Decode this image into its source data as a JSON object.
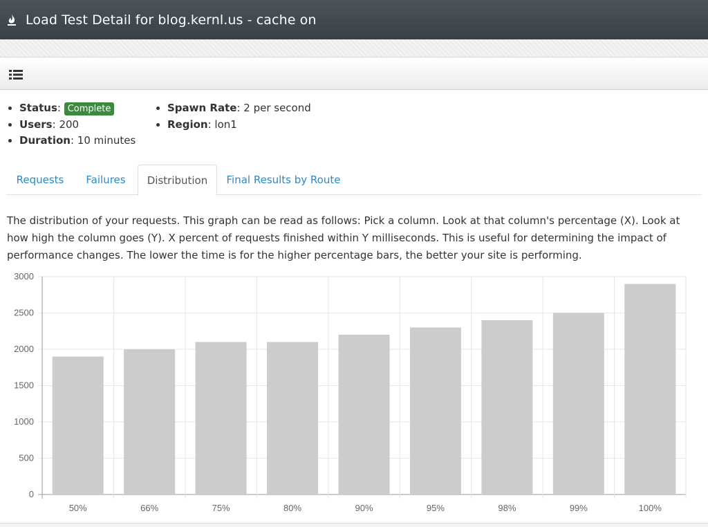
{
  "header": {
    "title": "Load Test Detail for blog.kernl.us - cache on",
    "icon": "flame-icon"
  },
  "toolbar": {
    "menu_icon": "list-icon"
  },
  "info": {
    "left": [
      {
        "key": "Status",
        "badge": "Complete"
      },
      {
        "key": "Users",
        "value": "200"
      },
      {
        "key": "Duration",
        "value": "10 minutes"
      }
    ],
    "right": [
      {
        "key": "Spawn Rate",
        "value": "2 per second"
      },
      {
        "key": "Region",
        "value": "lon1"
      }
    ],
    "badge_color": "#3c8a3e"
  },
  "tabs": [
    {
      "label": "Requests",
      "active": false
    },
    {
      "label": "Failures",
      "active": false
    },
    {
      "label": "Distribution",
      "active": true
    },
    {
      "label": "Final Results by Route",
      "active": false
    }
  ],
  "description": "The distribution of your requests. This graph can be read as follows: Pick a column. Look at that column's percentage (X). Look at how high the column goes (Y). X percent of requests finished within Y milliseconds. This is useful for determining the impact of performance changes. The lower the time is for the higher percentage bars, the better your site is performing.",
  "chart_data": {
    "type": "bar",
    "categories": [
      "50%",
      "66%",
      "75%",
      "80%",
      "90%",
      "95%",
      "98%",
      "99%",
      "100%"
    ],
    "values": [
      1900,
      2000,
      2100,
      2100,
      2200,
      2300,
      2400,
      2500,
      2900
    ],
    "ylim": [
      0,
      3000
    ],
    "yticks": [
      "0",
      "500",
      "1000",
      "1500",
      "2000",
      "2500",
      "3000"
    ],
    "ytick_values": [
      0,
      500,
      1000,
      1500,
      2000,
      2500,
      3000
    ],
    "grid": true,
    "bar_color": "#cccccc",
    "title": "",
    "xlabel": "",
    "ylabel": ""
  }
}
